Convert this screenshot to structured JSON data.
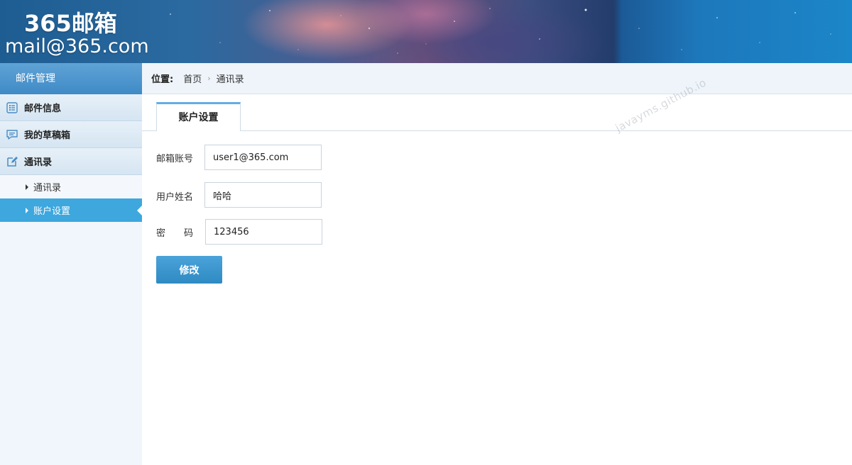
{
  "header": {
    "logo_title": "365邮箱",
    "logo_mail": "mail@365.com"
  },
  "sidebar": {
    "title": "邮件管理",
    "groups": [
      {
        "label": "邮件信息",
        "icon": "list-icon"
      },
      {
        "label": "我的草稿箱",
        "icon": "chat-bubble-icon"
      },
      {
        "label": "通讯录",
        "icon": "edit-icon"
      }
    ],
    "sub_items": [
      {
        "label": "通讯录",
        "active": false
      },
      {
        "label": "账户设置",
        "active": true
      }
    ]
  },
  "breadcrumb": {
    "label": "位置:",
    "items": [
      "首页",
      "通讯录"
    ]
  },
  "tab": {
    "label": "账户设置"
  },
  "form": {
    "fields": [
      {
        "label": "邮箱账号",
        "value": "user1@365.com"
      },
      {
        "label": "用户姓名",
        "value": "哈哈"
      },
      {
        "label": "密　　码",
        "value": "123456"
      }
    ],
    "submit_label": "修改"
  },
  "watermark": "javayms.github.io",
  "colors": {
    "sidebar_head": "#3f8ac6",
    "active_item": "#3da7de",
    "button": "#2f8ac3",
    "tab_accent": "#62aee3"
  }
}
